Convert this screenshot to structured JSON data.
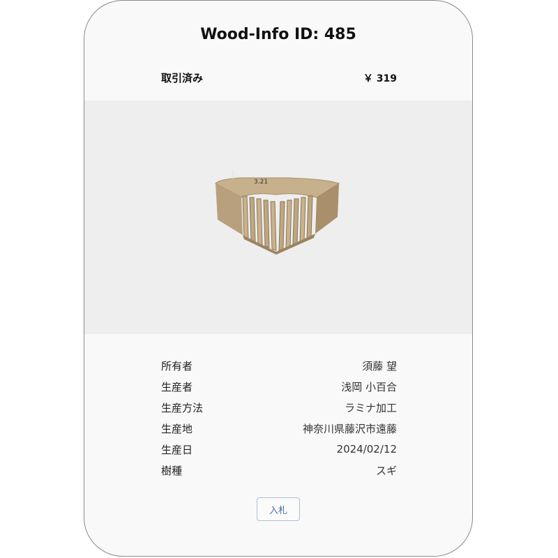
{
  "card": {
    "title": "Wood-Info ID: 485",
    "status": "取引済み",
    "price": "￥ 319"
  },
  "image": {
    "label": "wood-product-image",
    "handwriting": "3.21"
  },
  "details": [
    {
      "label": "所有者",
      "value": "須藤 望"
    },
    {
      "label": "生産者",
      "value": "浅岡 小百合"
    },
    {
      "label": "生産方法",
      "value": "ラミナ加工"
    },
    {
      "label": "生産地",
      "value": "神奈川県藤沢市遠藤"
    },
    {
      "label": "生産日",
      "value": "2024/02/12"
    },
    {
      "label": "樹種",
      "value": "スギ"
    }
  ],
  "actions": {
    "bid_label": "入札"
  },
  "colors": {
    "card_bg": "#f9f9f9",
    "image_bg": "#eeeeee",
    "button_text": "#4a6ea3",
    "wood": "#b59c78"
  }
}
